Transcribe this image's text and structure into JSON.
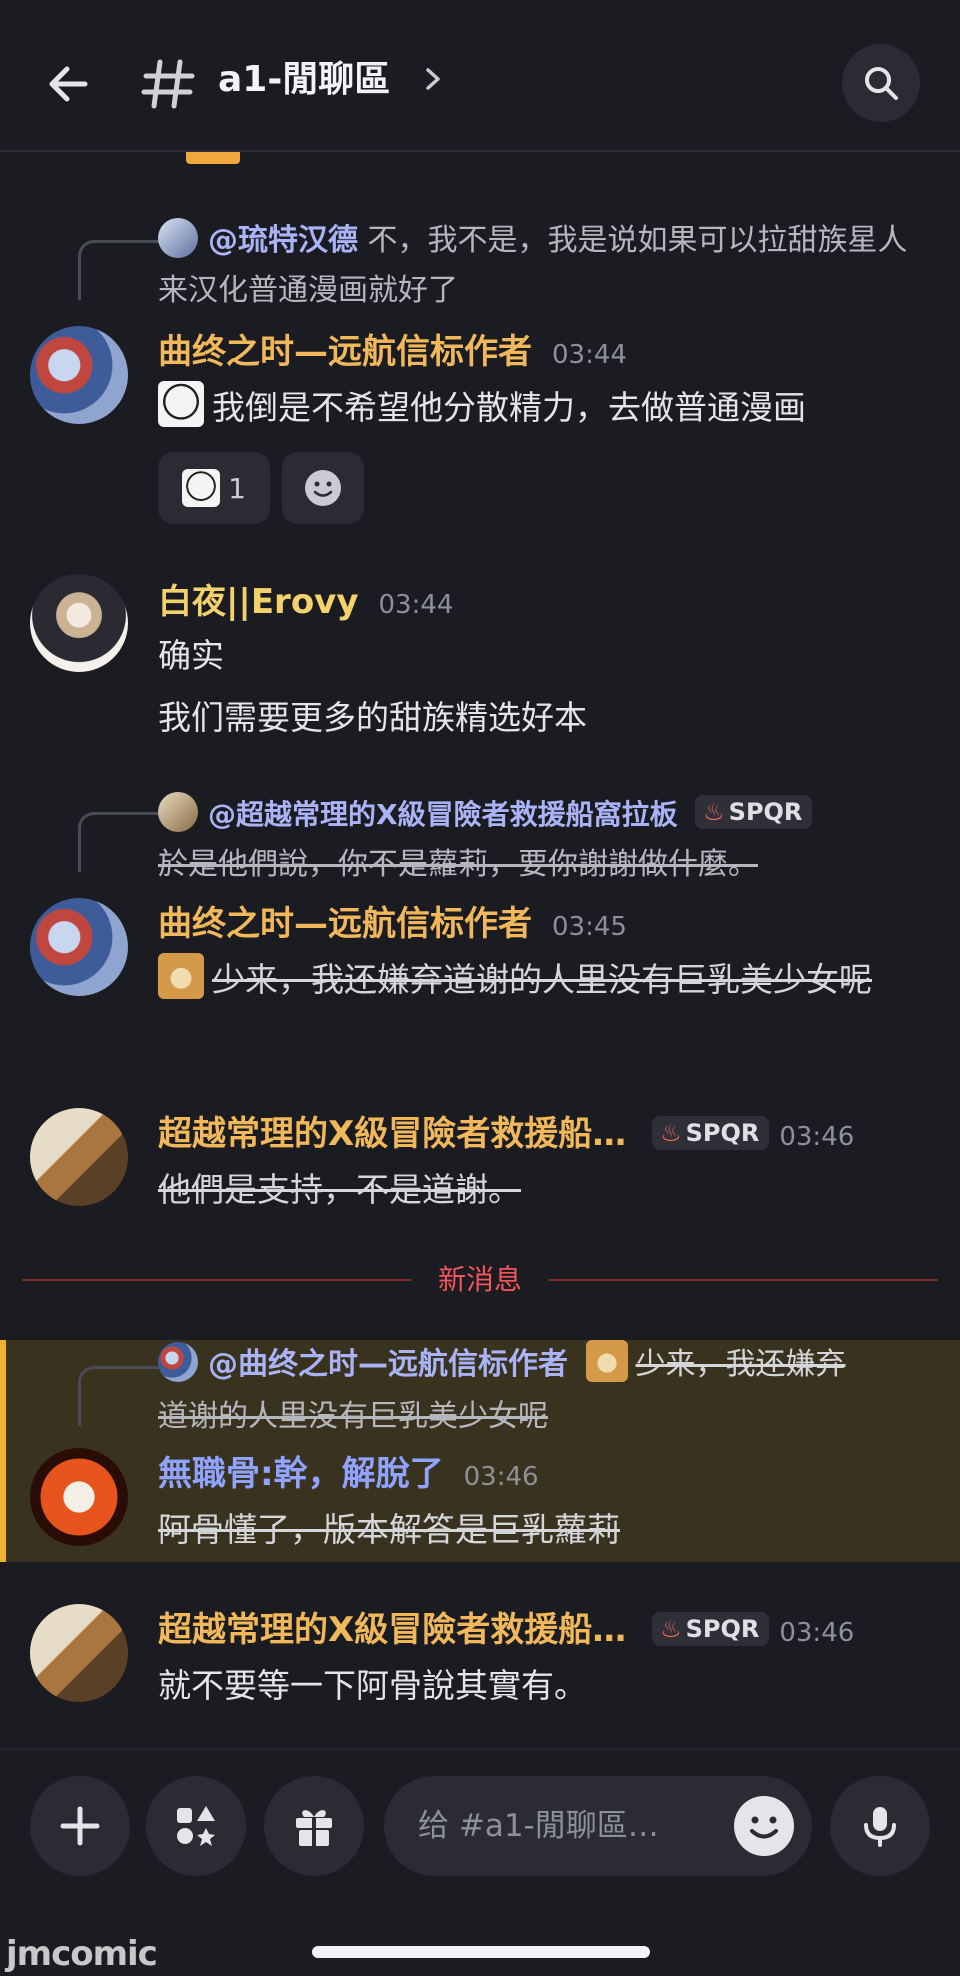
{
  "header": {
    "channel_name": "a1-閒聊區"
  },
  "messages": [
    {
      "reply_to": "@琉特汉德",
      "reply_text": "不，我不是，我是说如果可以拉甜族星人来汉化普通漫画就好了",
      "author": "曲终之时—远航信标作者",
      "time": "03:44",
      "text": "我倒是不希望他分散精力，去做普通漫画",
      "reaction_count": "1"
    },
    {
      "author": "白夜||Erovy",
      "time": "03:44",
      "line1": "确实",
      "line2": "我们需要更多的甜族精选好本"
    },
    {
      "reply_to": "@超越常理的X級冒險者救援船窩拉板",
      "reply_tag": "SPQR",
      "reply_text": "於是他們說，你不是蘿莉，要你謝謝做什麼。",
      "author": "曲终之时—远航信标作者",
      "time": "03:45",
      "text": "少来，我还嫌弃道谢的人里没有巨乳美少女呢"
    },
    {
      "author": "超越常理的X級冒險者救援船…",
      "tag": "SPQR",
      "time": "03:46",
      "text": "他們是支持，不是道謝。"
    },
    {
      "reply_to": "@曲终之时—远航信标作者",
      "reply_text_1": "少来，我还嫌弃",
      "reply_text_2": "道谢的人里没有巨乳美少女呢",
      "author": "無職骨:幹，解脫了",
      "time": "03:46",
      "text": "阿骨懂了，版本解答是巨乳蘿莉"
    },
    {
      "author": "超越常理的X級冒險者救援船…",
      "tag": "SPQR",
      "time": "03:46",
      "text": "就不要等一下阿骨說其實有。"
    }
  ],
  "divider": {
    "label": "新消息"
  },
  "composer": {
    "placeholder": "给 #a1-閒聊區…"
  },
  "watermark": "jmcomic",
  "colors": {
    "background": "#1b1b22",
    "author_gold": "#f0b85a",
    "author_yellow": "#f3d26b",
    "author_blue": "#8fa3ff",
    "new_divider": "#f2555a",
    "highlight": "#39321f"
  }
}
